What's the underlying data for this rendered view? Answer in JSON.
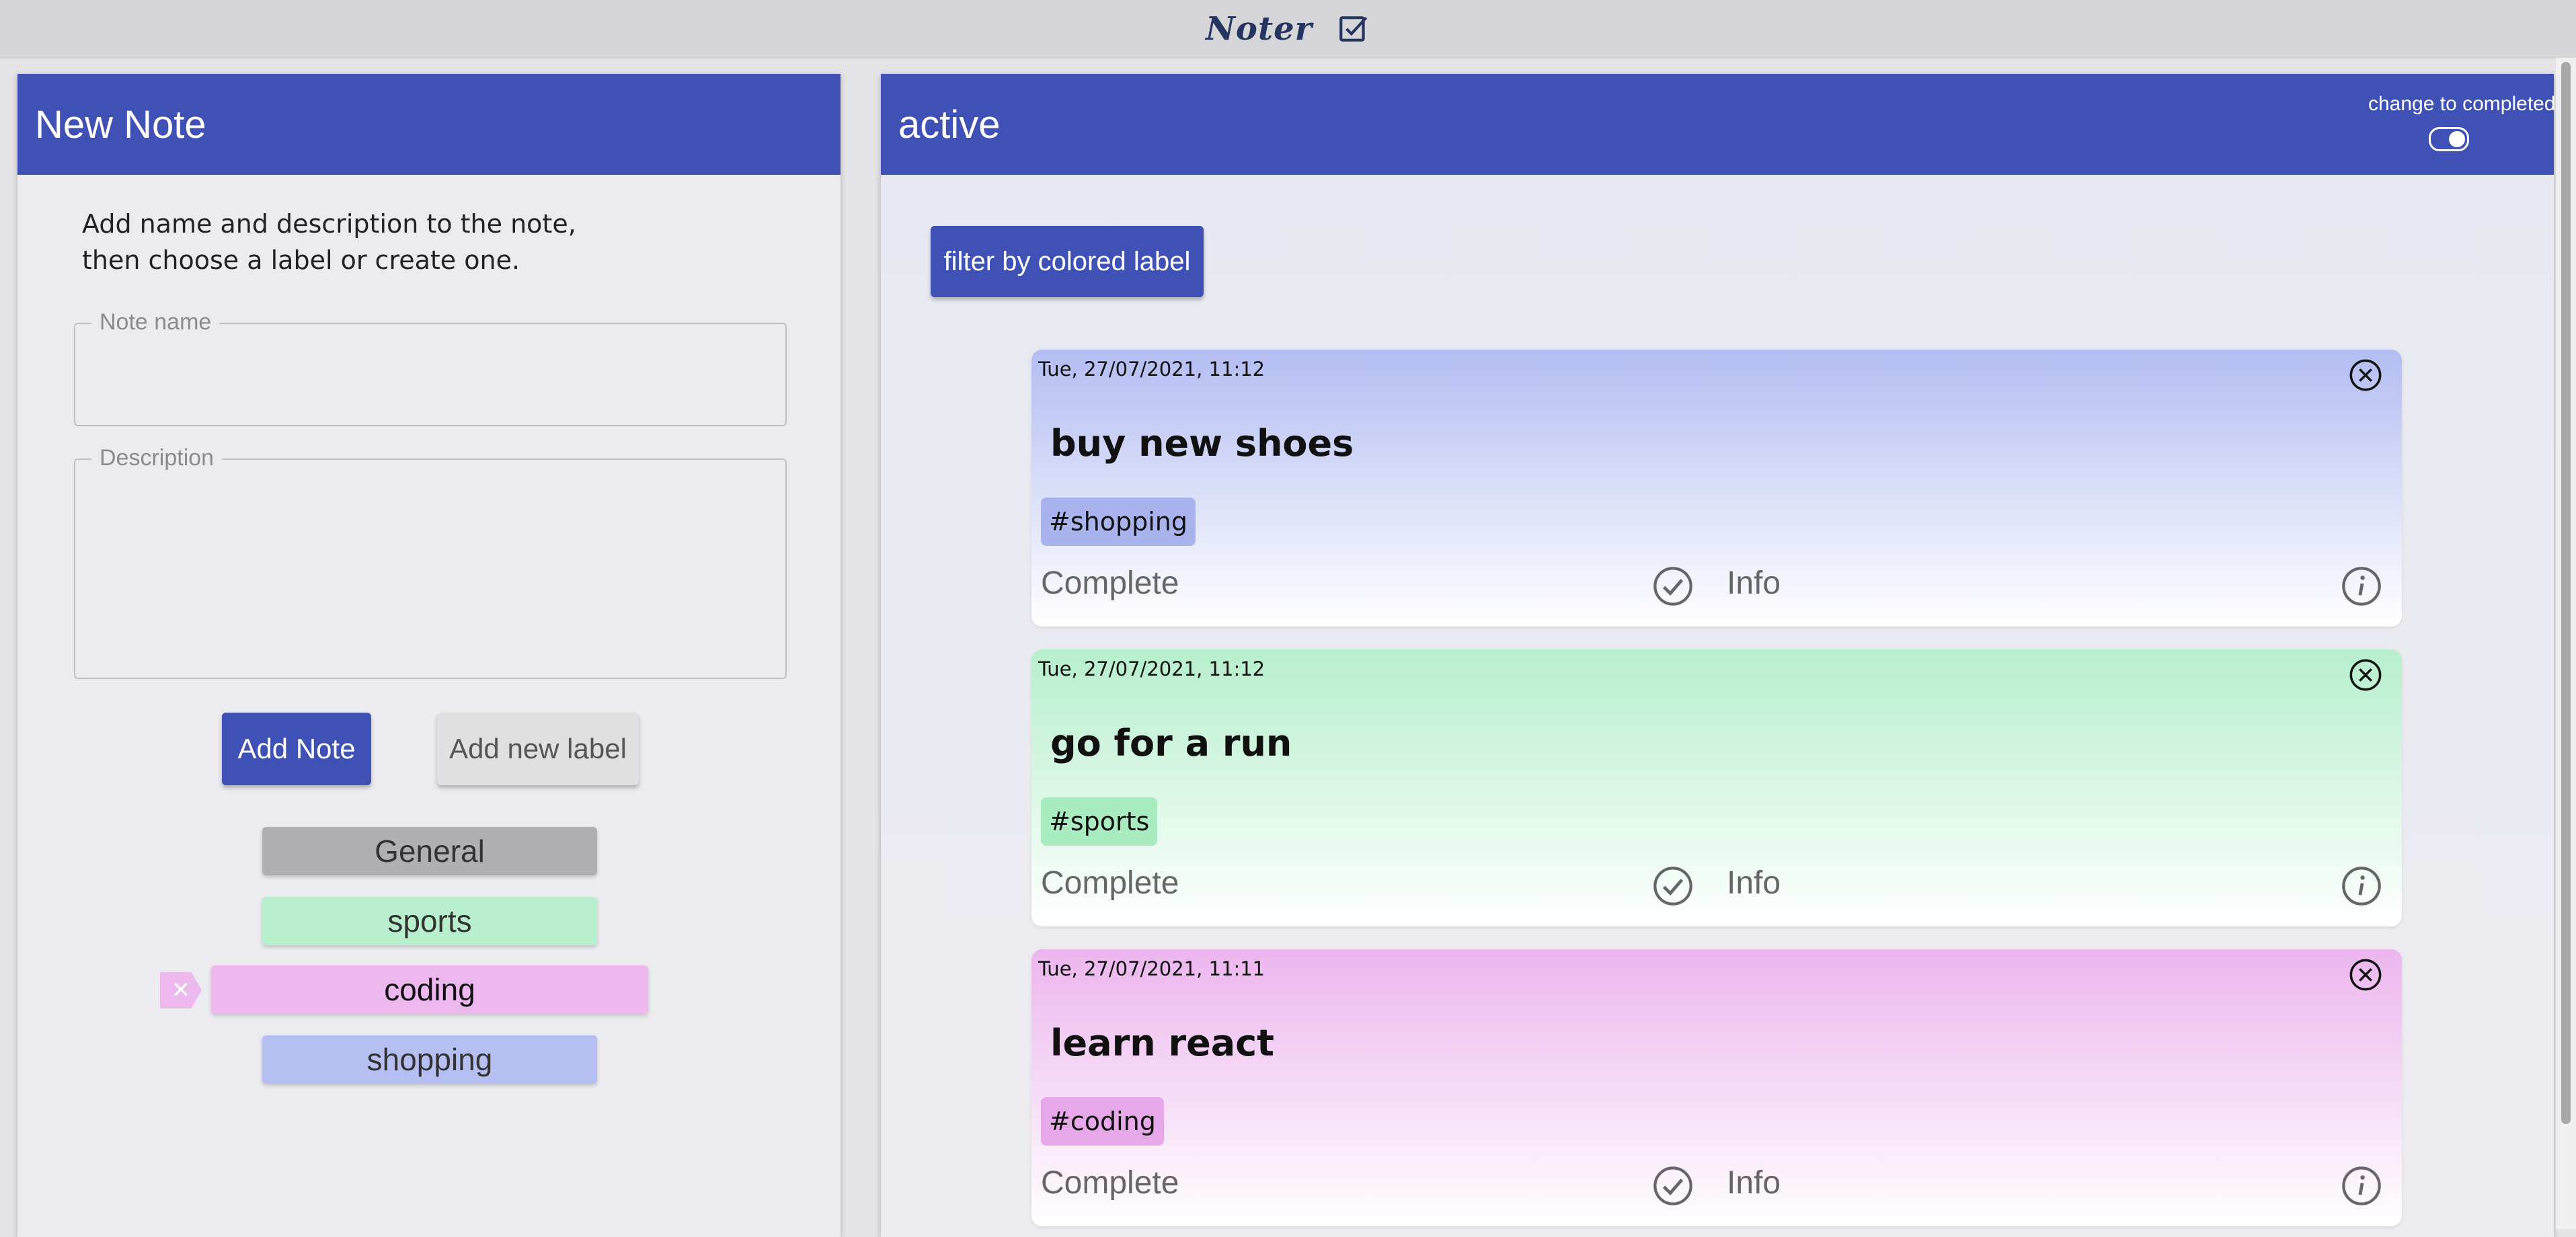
{
  "app": {
    "brand": "Noter",
    "brand_icon": "checkbox-icon"
  },
  "new_note": {
    "title": "New Note",
    "intro_line1": "Add name and description to the note,",
    "intro_line2": "then choose a label or create one.",
    "name_legend": "Note name",
    "name_value": "",
    "description_legend": "Description",
    "description_value": "",
    "add_note_label": "Add Note",
    "add_label_label": "Add new label",
    "labels": [
      {
        "name": "General",
        "color": "#b0b0b4"
      },
      {
        "name": "sports",
        "color": "#b8efcc"
      },
      {
        "name": "coding",
        "color": "#ecb8ee",
        "selected": true
      },
      {
        "name": "shopping",
        "color": "#b6bff2"
      }
    ],
    "remove_label_glyph": "✕"
  },
  "notes_panel": {
    "title": "active",
    "toggle_label": "change to completed",
    "toggle_on": true,
    "filter_label": "filter by colored label",
    "notes": [
      {
        "date": "Tue, 27/07/2021, 11:12",
        "title": "buy new shoes",
        "tag": "#shopping",
        "color": "#b3bdf2",
        "complete_label": "Complete",
        "info_label": "Info"
      },
      {
        "date": "Tue, 27/07/2021, 11:12",
        "title": "go for a run",
        "tag": "#sports",
        "color": "#b6efcc",
        "complete_label": "Complete",
        "info_label": "Info"
      },
      {
        "date": "Tue, 27/07/2021, 11:11",
        "title": "learn react",
        "tag": "#coding",
        "color": "#ecb6ee",
        "complete_label": "Complete",
        "info_label": "Info"
      }
    ]
  },
  "colors": {
    "primary": "#3f51b5",
    "brand_text": "#25355f"
  }
}
